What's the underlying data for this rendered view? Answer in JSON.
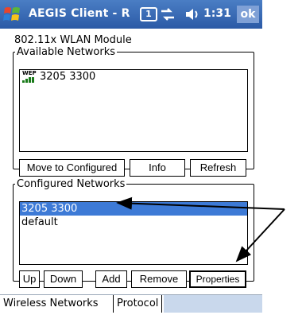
{
  "titlebar": {
    "title": "AEGIS Client - R",
    "time": "1:31",
    "ok_label": "ok",
    "nav_glyph": "1",
    "icons": [
      "windows-start-icon",
      "navigation-icon",
      "connectivity-icon",
      "volume-icon"
    ],
    "background_color": "#2b5aa6"
  },
  "module_label": "802.11x WLAN Module",
  "available": {
    "legend": "Available Networks",
    "items": [
      {
        "badge": "WEP",
        "label": "3205 3300",
        "icon": "wep-signal-icon"
      }
    ],
    "buttons": {
      "move": "Move to Configured",
      "info": "Info",
      "refresh": "Refresh"
    }
  },
  "configured": {
    "legend": "Configured Networks",
    "items": [
      {
        "label": "3205 3300",
        "selected": true
      },
      {
        "label": "default",
        "selected": false
      }
    ],
    "selection_color": "#3d7ad6",
    "buttons": {
      "up": "Up",
      "down": "Down",
      "add": "Add",
      "remove": "Remove",
      "properties": "Properties"
    }
  },
  "tabs": [
    {
      "label": "Wireless Networks",
      "active": true
    },
    {
      "label": "Protocol",
      "active": false
    }
  ]
}
